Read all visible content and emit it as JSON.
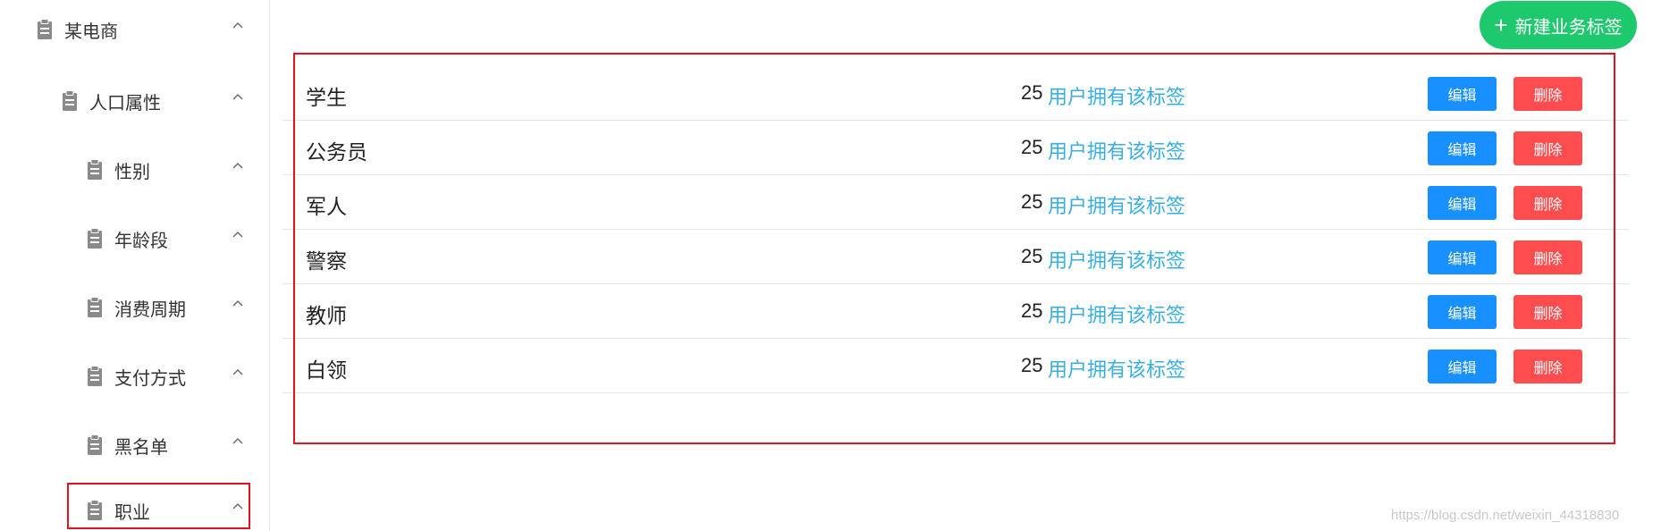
{
  "sidebar": {
    "nodes": [
      {
        "label": "某电商",
        "icon": "document-icon",
        "expanded": true
      },
      {
        "label": "人口属性",
        "icon": "document-icon",
        "expanded": true
      },
      {
        "label": "性别",
        "icon": "document-icon",
        "expanded": true
      },
      {
        "label": "年龄段",
        "icon": "document-icon",
        "expanded": true
      },
      {
        "label": "消费周期",
        "icon": "document-icon",
        "expanded": true
      },
      {
        "label": "支付方式",
        "icon": "document-icon",
        "expanded": true
      },
      {
        "label": "黑名单",
        "icon": "document-icon",
        "expanded": true
      },
      {
        "label": "职业",
        "icon": "document-icon",
        "expanded": true,
        "highlighted": true
      }
    ]
  },
  "toolbar": {
    "create_icon": "plus-icon",
    "create_label": "新建业务标签"
  },
  "tags": {
    "count_suffix": "用户拥有该标签",
    "edit_label": "编辑",
    "delete_label": "删除",
    "rows": [
      {
        "name": "学生",
        "count": "25"
      },
      {
        "name": "公务员",
        "count": "25"
      },
      {
        "name": "军人",
        "count": "25"
      },
      {
        "name": "警察",
        "count": "25"
      },
      {
        "name": "教师",
        "count": "25"
      },
      {
        "name": "白领",
        "count": "25"
      }
    ]
  },
  "watermark": "https://blog.csdn.net/weixin_44318830",
  "colors": {
    "create_button": "#1ec96e",
    "edit_button": "#1890ff",
    "delete_button": "#ff4d4f",
    "count_text": "#3aaee0",
    "annotation": "#e0141e"
  }
}
